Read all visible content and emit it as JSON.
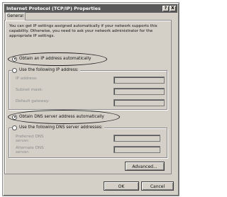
{
  "window": {
    "title": "Internet Protocol (TCP/IP) Properties",
    "help_glyph": "?",
    "close_glyph": "X"
  },
  "tabs": [
    {
      "label": "General"
    }
  ],
  "description": "You can get IP settings assigned automatically if your network supports this capability. Otherwise, you need to ask your network administrator for the appropriate IP settings.",
  "ip": {
    "auto_label": "Obtain an IP address automatically",
    "auto_selected": true,
    "manual_label": "Use the following IP address:",
    "fields": [
      {
        "label": "IP address:"
      },
      {
        "label": "Subnet mask:"
      },
      {
        "label": "Default gateway:"
      }
    ]
  },
  "dns": {
    "auto_label": "Obtain DNS server address automatically",
    "auto_selected": true,
    "manual_label": "Use the following DNS server addresses:",
    "fields": [
      {
        "label": "Preferred DNS server:"
      },
      {
        "label": "Alternate DNS server:"
      }
    ]
  },
  "buttons": {
    "advanced": "Advanced...",
    "ok": "OK",
    "cancel": "Cancel"
  },
  "colors": {
    "title_bar": "#5a5a5a",
    "dialog_face": "#d4d0c8",
    "annotation_oval": "#222222"
  }
}
